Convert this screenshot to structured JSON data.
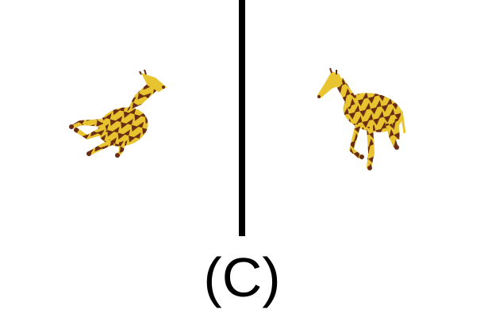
{
  "figure": {
    "caption": "(C)",
    "left_panel": {
      "icon": "giraffe-lying-icon"
    },
    "right_panel": {
      "icon": "giraffe-standing-icon"
    }
  },
  "colors": {
    "background": "#ffffff",
    "divider": "#000000",
    "giraffe_body": "#e8c530",
    "giraffe_patch": "#6b2c14",
    "caption_text": "#000000"
  }
}
